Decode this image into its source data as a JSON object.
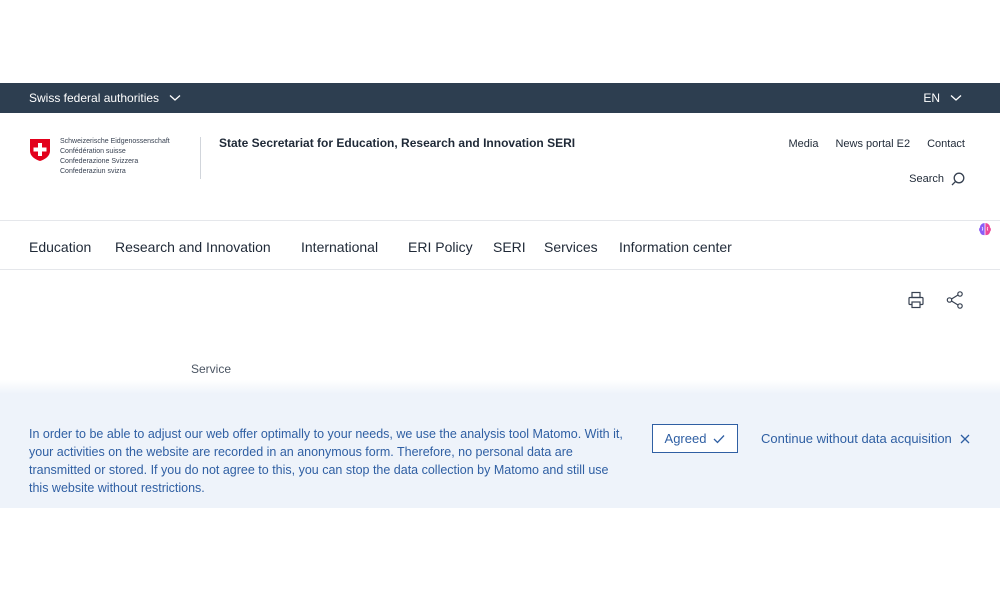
{
  "topbar": {
    "authorities_label": "Swiss federal authorities",
    "language": "EN"
  },
  "logo": {
    "lines": [
      "Schweizerische Eidgenossenschaft",
      "Confédération suisse",
      "Confederazione Svizzera",
      "Confederaziun svizra"
    ]
  },
  "header": {
    "site_title": "State Secretariat for Education, Research and Innovation SERI"
  },
  "meta_nav": [
    "Media",
    "News portal E2",
    "Contact"
  ],
  "search": {
    "label": "Search"
  },
  "main_nav": [
    "Education",
    "Research and Innovation",
    "International",
    "ERI Policy",
    "SERI",
    "Services",
    "Information center"
  ],
  "page": {
    "service_label": "Service"
  },
  "consent": {
    "text": "In order to be able to adjust our web offer optimally to your needs, we use the analysis tool Matomo. With it, your activities on the website are recorded in an anonymous form. Therefore, no personal data are transmitted or stored. If you do not agree to this, you can stop the data collection by Matomo and still use this website without restrictions.",
    "agreed_label": "Agreed",
    "continue_label": "Continue without data acquisition"
  },
  "icons": [
    "chevron-down-icon",
    "swiss-cross-icon",
    "search-icon",
    "brain-icon",
    "print-icon",
    "share-icon",
    "check-icon",
    "close-icon"
  ],
  "colors": {
    "topbar_bg": "#2d3e50",
    "consent_bg": "#eef3fa",
    "consent_text": "#2f5fa3",
    "swiss_red": "#e3001b"
  }
}
